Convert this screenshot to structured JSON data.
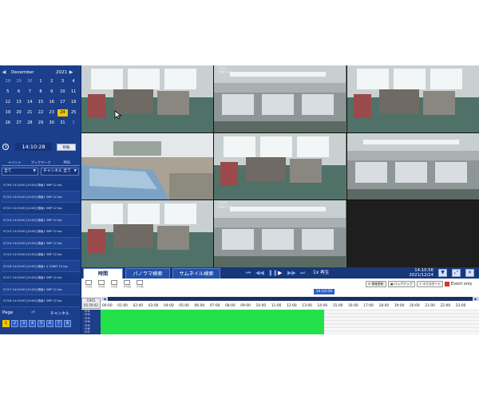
{
  "calendar": {
    "month": "December",
    "year": "2021",
    "prev_icon": "chevron-left-icon",
    "next_icon": "chevron-right-icon",
    "weeks": [
      [
        "28",
        "29",
        "30",
        "1",
        "2",
        "3",
        "4"
      ],
      [
        "5",
        "6",
        "7",
        "8",
        "9",
        "10",
        "11"
      ],
      [
        "12",
        "13",
        "14",
        "15",
        "16",
        "17",
        "18"
      ],
      [
        "19",
        "20",
        "21",
        "22",
        "23",
        "24",
        "25"
      ],
      [
        "26",
        "27",
        "28",
        "29",
        "30",
        "31",
        "1"
      ]
    ],
    "selected_day": "24"
  },
  "time_search": {
    "time": "14:10:28",
    "move_label": "移動"
  },
  "list_tabs": [
    "イベント",
    "ブックマーク",
    "POS"
  ],
  "filters": {
    "event_type": "全て",
    "channel": "チャンネル 全て"
  },
  "events": [
    "07/09 14:20:00 [10:00] 録画1 5MP 12 fps",
    "07/10 14:20:00 [10:00] 録画1 5MP 12 fps",
    "07/13 14:20:00 [10:00] 録画1 5MP 12 fps",
    "07/13 14:20:00 [10:00] 録画1 5MP 12 fps",
    "07/13 14:20:00 [10:00] 録画1 5MP 12 fps",
    "07/14 14:20:00 [10:00] 録画1 5MP 12 fps",
    "07/15 14:20:00 [10:00] 録画1 5MP 12 fps",
    "07/16 14:20:00 [10:00] 録画1 4 1080P 15 fps",
    "07/17 14:20:00 [10:00] 録画1 5MP 12 fps",
    "07/17 14:20:00 [10:00] 録画1 5MP 12 fps",
    "07/18 14:20:00 [10:00] 録画1 5MP 12 fps"
  ],
  "paging": {
    "label": "Page",
    "channel_label": "チャンネル",
    "back_icon": "return-icon",
    "pages": [
      "1",
      "2",
      "3",
      "4",
      "5",
      "6",
      "7",
      "8"
    ],
    "current_page": "1"
  },
  "cameras": [
    {
      "label": "",
      "scene": "office"
    },
    {
      "label": "CH 2\n5MP 12",
      "scene": "ceiling"
    },
    {
      "label": "",
      "scene": "office"
    },
    {
      "label": "2021-12-24 14:10:56",
      "scene": "outdoor"
    },
    {
      "label": "",
      "scene": "office"
    },
    {
      "label": "",
      "scene": "ceiling"
    },
    {
      "label": "",
      "scene": "office"
    },
    {
      "label": "CH 8\n5MP 12",
      "scene": "ceiling"
    },
    {
      "label": "",
      "scene": "blank"
    }
  ],
  "control_bar": {
    "tabs": [
      "時間",
      "パノラマ検索",
      "サムネイル検索"
    ],
    "active_tab": "時間",
    "speed_label": "1x 再生",
    "current_time": "14:10:56",
    "current_date": "2021/12/24",
    "play_icon": "play-icon"
  },
  "timeline": {
    "layouts": [
      "1分割",
      "4分割",
      "9分割",
      "16分割",
      "その他"
    ],
    "marker_time": "14:10:56",
    "buttons": [
      "情報更新",
      "バックアップ",
      "エクスポート"
    ],
    "event_only_label": "Event only",
    "channel_box": "CH01\n05:59:02",
    "hours": [
      "00:00",
      "01:00",
      "02:00",
      "03:00",
      "04:00",
      "05:00",
      "06:00",
      "07:00",
      "08:00",
      "09:00",
      "10:00",
      "11:00",
      "12:00",
      "13:00",
      "14:00",
      "15:00",
      "16:00",
      "17:00",
      "18:00",
      "19:00",
      "20:00",
      "21:00",
      "22:00",
      "23:00"
    ],
    "channels": [
      "CH1",
      "CH2",
      "CH3",
      "CH4",
      "CH5",
      "CH6",
      "CH7"
    ],
    "recorded_until_hour": 14.18,
    "colors": {
      "recorded": "#22e14a",
      "accent": "#1c3f8c",
      "selected": "#f2c300"
    }
  }
}
